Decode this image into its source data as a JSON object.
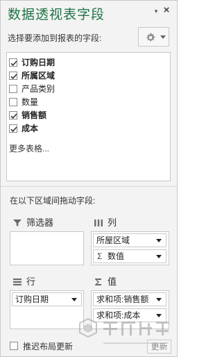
{
  "pane": {
    "title": "数据透视表字段",
    "dropdown_glyph": "▾",
    "close_glyph": "×",
    "choose_fields_label": "选择要添加到报表的字段:",
    "gear_icon": "gear-icon"
  },
  "fields": [
    {
      "label": "订购日期",
      "checked": true
    },
    {
      "label": "所属区域",
      "checked": true
    },
    {
      "label": "产品类别",
      "checked": false
    },
    {
      "label": "数量",
      "checked": false
    },
    {
      "label": "销售额",
      "checked": true
    },
    {
      "label": "成本",
      "checked": true
    }
  ],
  "more_tables_label": "更多表格...",
  "drag_label": "在以下区域间拖动字段:",
  "areas": {
    "filters": {
      "label": "筛选器",
      "icon": "filter-icon",
      "items": []
    },
    "columns": {
      "label": "列",
      "icon": "columns-icon",
      "items": [
        "所屋区域",
        "数值"
      ]
    },
    "rows": {
      "label": "行",
      "icon": "rows-icon",
      "items": [
        "订购日期"
      ]
    },
    "values": {
      "label": "值",
      "icon": "sigma-icon",
      "items": [
        "求和项:销售额",
        "求和项:成本"
      ]
    }
  },
  "footer": {
    "defer_update_label": "推迟布局更新",
    "update_button_label": "更新",
    "defer_checked": false
  },
  "watermark": {
    "text": "系统之家"
  },
  "colors": {
    "title": "#217346",
    "background": "#f3f3f3",
    "border": "#c8c8c8"
  }
}
